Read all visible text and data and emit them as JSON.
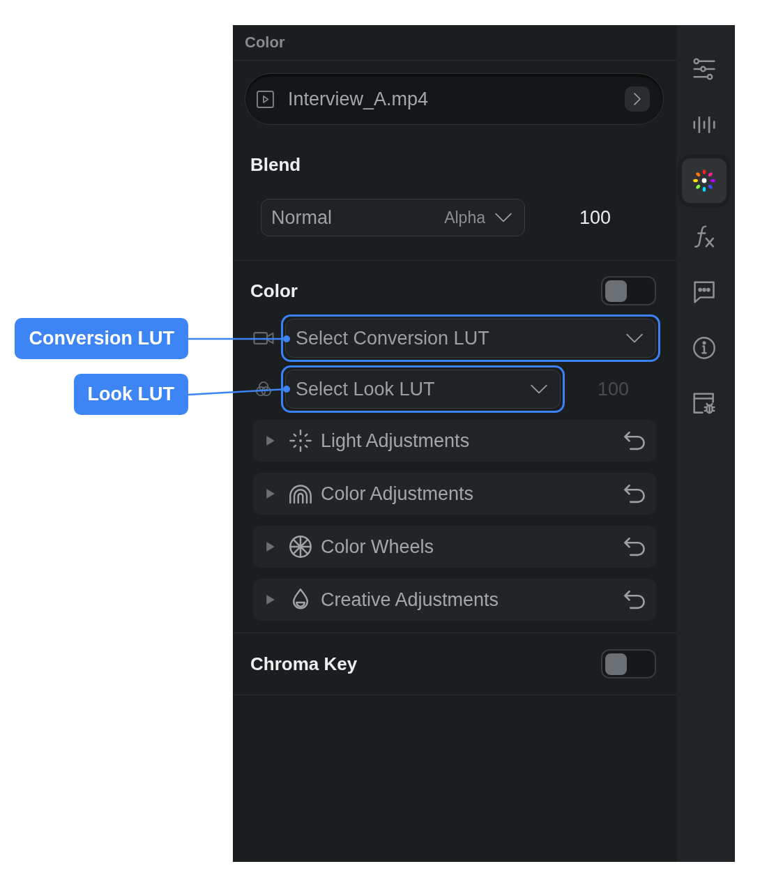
{
  "panel": {
    "title": "Color"
  },
  "clip": {
    "name": "Interview_A.mp4"
  },
  "blend": {
    "title": "Blend",
    "mode": "Normal",
    "mask": "Alpha",
    "opacity": "100"
  },
  "color": {
    "title": "Color",
    "on": false,
    "luts": [
      {
        "kind": "conversion",
        "placeholder": "Select Conversion LUT",
        "callout": "Conversion LUT"
      },
      {
        "kind": "look",
        "placeholder": "Select Look LUT",
        "intensity": "100",
        "intensity_disabled": true,
        "callout": "Look LUT"
      }
    ],
    "adjustments": [
      {
        "kind": "light",
        "label": "Light Adjustments",
        "expanded": false
      },
      {
        "kind": "color",
        "label": "Color Adjustments",
        "expanded": false
      },
      {
        "kind": "wheels",
        "label": "Color Wheels",
        "expanded": false
      },
      {
        "kind": "creative",
        "label": "Creative Adjustments",
        "expanded": false
      }
    ]
  },
  "chroma_key": {
    "title": "Chroma Key",
    "on": false
  },
  "sidebar": {
    "tabs": [
      {
        "kind": "adjust",
        "selected": false
      },
      {
        "kind": "audio",
        "selected": false
      },
      {
        "kind": "color",
        "selected": true
      },
      {
        "kind": "effects",
        "selected": false
      },
      {
        "kind": "captions",
        "selected": false
      },
      {
        "kind": "info",
        "selected": false
      },
      {
        "kind": "debug",
        "selected": false
      }
    ]
  }
}
